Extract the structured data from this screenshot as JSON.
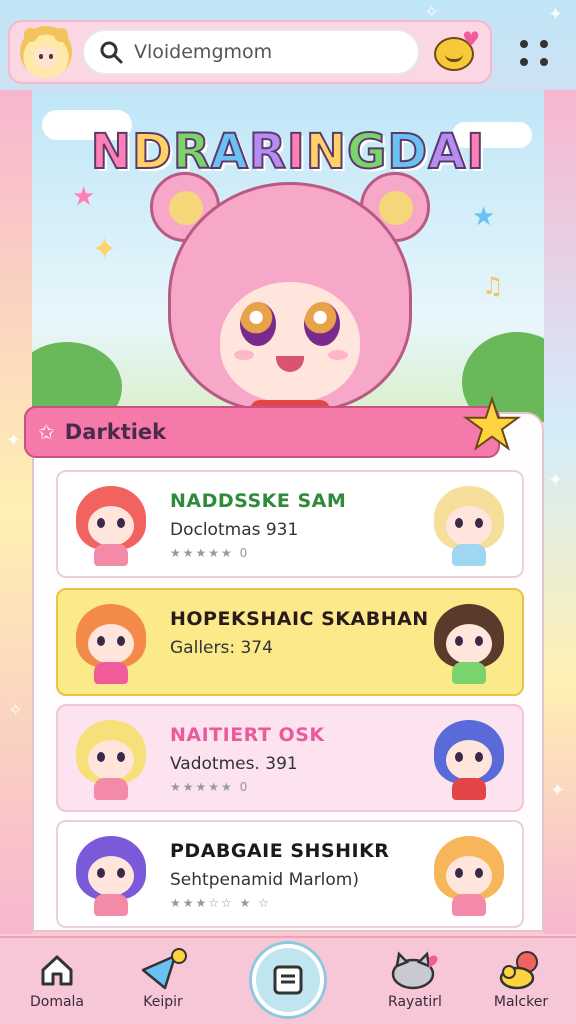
{
  "header": {
    "search_value": "Vloidemgmom"
  },
  "hero": {
    "title": "NDRARINGDAI"
  },
  "panel": {
    "title": "Darktiek"
  },
  "cards": [
    {
      "title": "NADDSSKE SAM",
      "subtitle": "Doclotmas 931",
      "rating": "★★★★★ 0",
      "title_color": "#2f8a3a"
    },
    {
      "title": "HOPEKSHAIC SKABHAN",
      "subtitle": "Gallers: 374",
      "rating": "",
      "title_color": "#2a1a1a"
    },
    {
      "title": "NAITIERT OSK",
      "subtitle": "Vadotmes. 391",
      "rating": "★★★★★ 0",
      "title_color": "#ec5a9a"
    },
    {
      "title": "PDABGAIE SHSHIKR",
      "subtitle": "Sehtpenamid Marlom)",
      "rating": "★★★☆☆ ★ ☆",
      "title_color": "#1a1a1a"
    }
  ],
  "nav": {
    "items": [
      {
        "label": "Domala"
      },
      {
        "label": "Keipir"
      },
      {
        "label": "Rayatirl"
      },
      {
        "label": "Malcker"
      }
    ]
  },
  "colors": {
    "accent_pink": "#f57aaa",
    "card_yellow": "#fce98a",
    "card_pink": "#fce3ef",
    "nav_bg": "#f8c7d7"
  },
  "icons": [
    "search-icon",
    "menu-dots-icon",
    "home-icon",
    "kite-icon",
    "center-menu-icon",
    "cat-icon",
    "duck-icon",
    "star-icon"
  ]
}
